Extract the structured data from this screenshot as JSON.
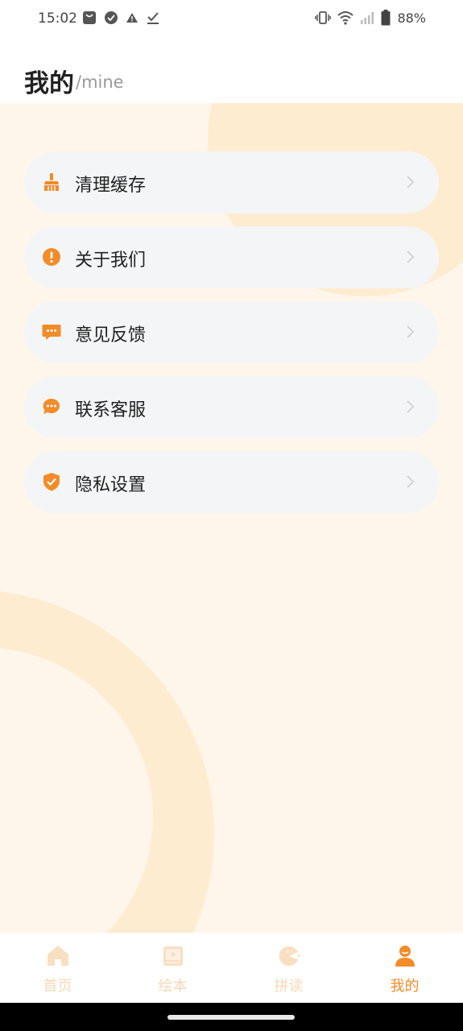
{
  "status_bar": {
    "time": "15:02",
    "battery_percent": "88%",
    "icons_left": [
      "shopping-bag-icon",
      "check-circle-icon",
      "warning-icon",
      "download-done-icon"
    ],
    "icons_right": [
      "vibrate-icon",
      "wifi-icon",
      "signal-icon",
      "battery-icon"
    ]
  },
  "header": {
    "title": "我的",
    "subtitle": "/mine"
  },
  "menu": {
    "items": [
      {
        "label": "清理缓存",
        "icon": "broom-icon"
      },
      {
        "label": "关于我们",
        "icon": "info-alert-icon"
      },
      {
        "label": "意见反馈",
        "icon": "feedback-message-icon"
      },
      {
        "label": "联系客服",
        "icon": "chat-bubble-icon"
      },
      {
        "label": "隐私设置",
        "icon": "shield-check-icon"
      }
    ]
  },
  "tabbar": {
    "tabs": [
      {
        "label": "首页",
        "icon": "home-icon",
        "active": false
      },
      {
        "label": "绘本",
        "icon": "picture-book-icon",
        "active": false
      },
      {
        "label": "拼读",
        "icon": "phonics-icon",
        "active": false
      },
      {
        "label": "我的",
        "icon": "profile-icon",
        "active": true
      }
    ]
  },
  "colors": {
    "accent": "#f28c28",
    "inactive_tab": "#f7d8b5",
    "background": "#fef6ea",
    "card": "#f4f5f6"
  }
}
